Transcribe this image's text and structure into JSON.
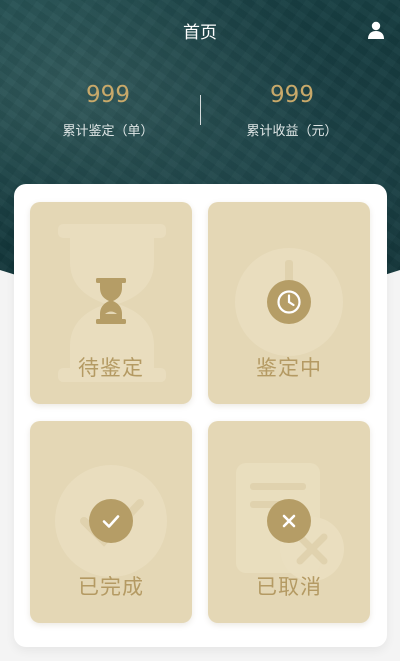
{
  "header": {
    "title": "首页",
    "user_icon": "user-icon"
  },
  "stats": [
    {
      "value": "999",
      "label": "累计鉴定（单）"
    },
    {
      "value": "999",
      "label": "累计收益（元）"
    }
  ],
  "cards": [
    {
      "label": "待鉴定",
      "icon": "hourglass-icon"
    },
    {
      "label": "鉴定中",
      "icon": "clock-icon"
    },
    {
      "label": "已完成",
      "icon": "check-icon"
    },
    {
      "label": "已取消",
      "icon": "cancel-icon"
    }
  ],
  "colors": {
    "accent_gold": "#b59d66",
    "card_bg": "#e4d7b5",
    "header_teal": "#153a3e"
  }
}
